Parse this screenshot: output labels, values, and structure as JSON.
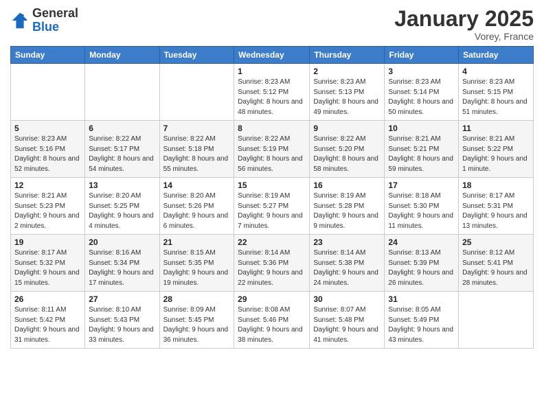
{
  "header": {
    "logo_general": "General",
    "logo_blue": "Blue",
    "month_title": "January 2025",
    "location": "Vorey, France"
  },
  "days_of_week": [
    "Sunday",
    "Monday",
    "Tuesday",
    "Wednesday",
    "Thursday",
    "Friday",
    "Saturday"
  ],
  "weeks": [
    [
      {
        "day": "",
        "info": ""
      },
      {
        "day": "",
        "info": ""
      },
      {
        "day": "",
        "info": ""
      },
      {
        "day": "1",
        "info": "Sunrise: 8:23 AM\nSunset: 5:12 PM\nDaylight: 8 hours and 48 minutes."
      },
      {
        "day": "2",
        "info": "Sunrise: 8:23 AM\nSunset: 5:13 PM\nDaylight: 8 hours and 49 minutes."
      },
      {
        "day": "3",
        "info": "Sunrise: 8:23 AM\nSunset: 5:14 PM\nDaylight: 8 hours and 50 minutes."
      },
      {
        "day": "4",
        "info": "Sunrise: 8:23 AM\nSunset: 5:15 PM\nDaylight: 8 hours and 51 minutes."
      }
    ],
    [
      {
        "day": "5",
        "info": "Sunrise: 8:23 AM\nSunset: 5:16 PM\nDaylight: 8 hours and 52 minutes."
      },
      {
        "day": "6",
        "info": "Sunrise: 8:22 AM\nSunset: 5:17 PM\nDaylight: 8 hours and 54 minutes."
      },
      {
        "day": "7",
        "info": "Sunrise: 8:22 AM\nSunset: 5:18 PM\nDaylight: 8 hours and 55 minutes."
      },
      {
        "day": "8",
        "info": "Sunrise: 8:22 AM\nSunset: 5:19 PM\nDaylight: 8 hours and 56 minutes."
      },
      {
        "day": "9",
        "info": "Sunrise: 8:22 AM\nSunset: 5:20 PM\nDaylight: 8 hours and 58 minutes."
      },
      {
        "day": "10",
        "info": "Sunrise: 8:21 AM\nSunset: 5:21 PM\nDaylight: 8 hours and 59 minutes."
      },
      {
        "day": "11",
        "info": "Sunrise: 8:21 AM\nSunset: 5:22 PM\nDaylight: 9 hours and 1 minute."
      }
    ],
    [
      {
        "day": "12",
        "info": "Sunrise: 8:21 AM\nSunset: 5:23 PM\nDaylight: 9 hours and 2 minutes."
      },
      {
        "day": "13",
        "info": "Sunrise: 8:20 AM\nSunset: 5:25 PM\nDaylight: 9 hours and 4 minutes."
      },
      {
        "day": "14",
        "info": "Sunrise: 8:20 AM\nSunset: 5:26 PM\nDaylight: 9 hours and 6 minutes."
      },
      {
        "day": "15",
        "info": "Sunrise: 8:19 AM\nSunset: 5:27 PM\nDaylight: 9 hours and 7 minutes."
      },
      {
        "day": "16",
        "info": "Sunrise: 8:19 AM\nSunset: 5:28 PM\nDaylight: 9 hours and 9 minutes."
      },
      {
        "day": "17",
        "info": "Sunrise: 8:18 AM\nSunset: 5:30 PM\nDaylight: 9 hours and 11 minutes."
      },
      {
        "day": "18",
        "info": "Sunrise: 8:17 AM\nSunset: 5:31 PM\nDaylight: 9 hours and 13 minutes."
      }
    ],
    [
      {
        "day": "19",
        "info": "Sunrise: 8:17 AM\nSunset: 5:32 PM\nDaylight: 9 hours and 15 minutes."
      },
      {
        "day": "20",
        "info": "Sunrise: 8:16 AM\nSunset: 5:34 PM\nDaylight: 9 hours and 17 minutes."
      },
      {
        "day": "21",
        "info": "Sunrise: 8:15 AM\nSunset: 5:35 PM\nDaylight: 9 hours and 19 minutes."
      },
      {
        "day": "22",
        "info": "Sunrise: 8:14 AM\nSunset: 5:36 PM\nDaylight: 9 hours and 22 minutes."
      },
      {
        "day": "23",
        "info": "Sunrise: 8:14 AM\nSunset: 5:38 PM\nDaylight: 9 hours and 24 minutes."
      },
      {
        "day": "24",
        "info": "Sunrise: 8:13 AM\nSunset: 5:39 PM\nDaylight: 9 hours and 26 minutes."
      },
      {
        "day": "25",
        "info": "Sunrise: 8:12 AM\nSunset: 5:41 PM\nDaylight: 9 hours and 28 minutes."
      }
    ],
    [
      {
        "day": "26",
        "info": "Sunrise: 8:11 AM\nSunset: 5:42 PM\nDaylight: 9 hours and 31 minutes."
      },
      {
        "day": "27",
        "info": "Sunrise: 8:10 AM\nSunset: 5:43 PM\nDaylight: 9 hours and 33 minutes."
      },
      {
        "day": "28",
        "info": "Sunrise: 8:09 AM\nSunset: 5:45 PM\nDaylight: 9 hours and 36 minutes."
      },
      {
        "day": "29",
        "info": "Sunrise: 8:08 AM\nSunset: 5:46 PM\nDaylight: 9 hours and 38 minutes."
      },
      {
        "day": "30",
        "info": "Sunrise: 8:07 AM\nSunset: 5:48 PM\nDaylight: 9 hours and 41 minutes."
      },
      {
        "day": "31",
        "info": "Sunrise: 8:05 AM\nSunset: 5:49 PM\nDaylight: 9 hours and 43 minutes."
      },
      {
        "day": "",
        "info": ""
      }
    ]
  ]
}
